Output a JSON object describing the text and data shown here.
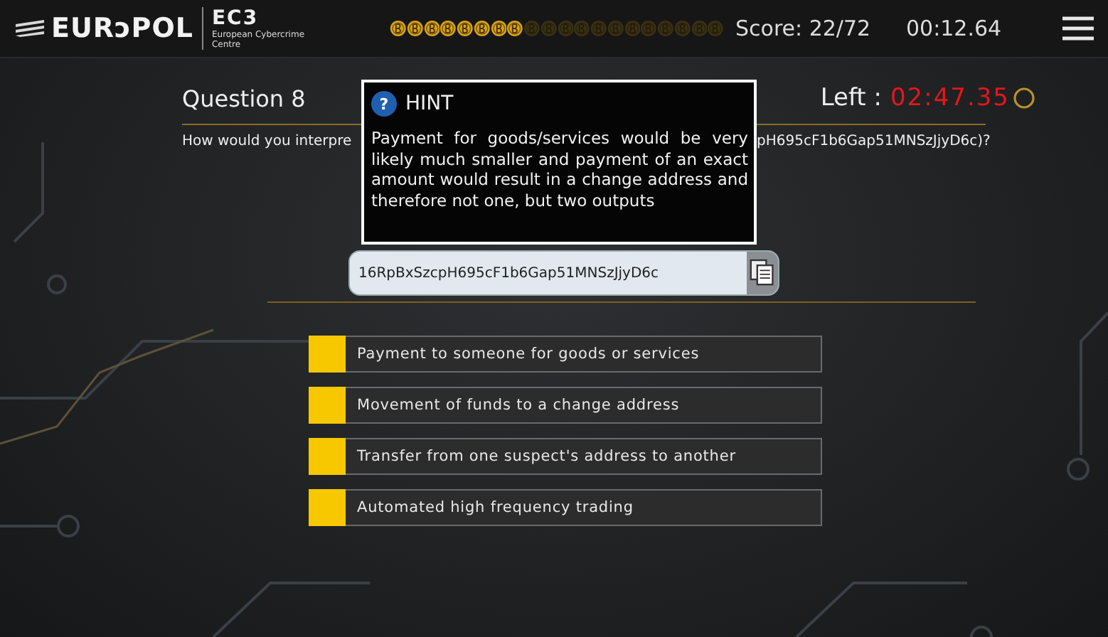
{
  "header": {
    "logo": "EURɔPOL",
    "unit": "EC3",
    "unit_name": "European Cybercrime Centre",
    "coins": [
      {
        "earned": true
      },
      {
        "earned": true
      },
      {
        "earned": true
      },
      {
        "earned": true
      },
      {
        "earned": true
      },
      {
        "earned": true
      },
      {
        "earned": true
      },
      {
        "earned": true
      },
      {
        "earned": false
      },
      {
        "earned": false
      },
      {
        "earned": false
      },
      {
        "earned": false
      },
      {
        "earned": false
      },
      {
        "earned": false
      },
      {
        "earned": false
      },
      {
        "earned": false
      },
      {
        "earned": false
      },
      {
        "earned": false
      },
      {
        "earned": false
      },
      {
        "earned": false
      }
    ],
    "score": "Score: 22/72",
    "elapsed": "00:12.64"
  },
  "question": {
    "title": "Question 8",
    "time_label": "Left :",
    "time_left": "02:47.35",
    "text_before": "How would you interpre",
    "text_after": "pH695cF1b6Gap51MNSzJjyD6c)?"
  },
  "hint": {
    "icon": "?",
    "title": "HINT",
    "text": "Payment for goods/services would be very likely much smaller and payment of an exact amount would result in a change address and therefore not one, but two outputs"
  },
  "address": {
    "value": "16RpBxSzcpH695cF1b6Gap51MNSzJjyD6c"
  },
  "options": [
    {
      "label": "Payment to someone for goods or services"
    },
    {
      "label": "Movement of funds to a change address"
    },
    {
      "label": "Transfer from one suspect's address to another"
    },
    {
      "label": "Automated high frequency trading"
    }
  ]
}
